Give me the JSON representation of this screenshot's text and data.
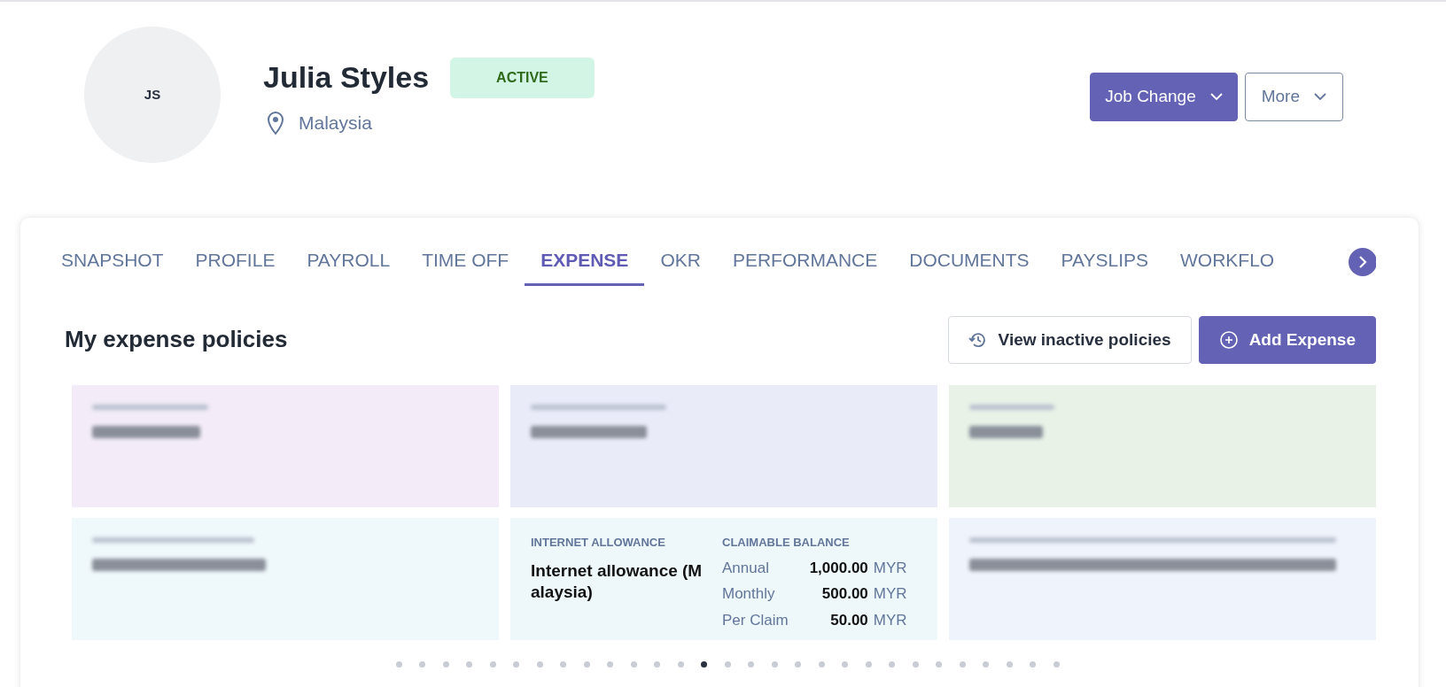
{
  "profile": {
    "initials": "JS",
    "name": "Julia Styles",
    "status": "ACTIVE",
    "location": "Malaysia"
  },
  "actions": [
    {
      "label": "Job Change",
      "kind": "primary"
    },
    {
      "label": "More",
      "kind": "outline"
    }
  ],
  "tabs": [
    {
      "label": "SNAPSHOT",
      "selected": false
    },
    {
      "label": "PROFILE",
      "selected": false
    },
    {
      "label": "PAYROLL",
      "selected": false
    },
    {
      "label": "TIME OFF",
      "selected": false
    },
    {
      "label": "EXPENSE",
      "selected": true
    },
    {
      "label": "OKR",
      "selected": false
    },
    {
      "label": "PERFORMANCE",
      "selected": false
    },
    {
      "label": "DOCUMENTS",
      "selected": false
    },
    {
      "label": "PAYSLIPS",
      "selected": false
    },
    {
      "label": "WORKFLO",
      "selected": false
    }
  ],
  "section": {
    "title": "My expense policies",
    "buttons": [
      {
        "label": "View inactive policies",
        "kind": "outline"
      },
      {
        "label": "Add Expense",
        "kind": "primary"
      }
    ]
  },
  "policies": [
    {
      "color": "#f3ebf8",
      "blurred": true
    },
    {
      "color": "#e9ebf8",
      "blurred": true
    },
    {
      "color": "#e8f2e7",
      "blurred": true
    },
    {
      "color": "#eff8fb",
      "blurred": true
    },
    {
      "category": "INTERNET ALLOWANCE",
      "name": "Internet allowance (M alaysia)",
      "color": "#eef7fa",
      "blurred": false,
      "balance_title": "CLAIMABLE BALANCE",
      "balances": [
        {
          "label": "Annual",
          "amount": "1,000.00",
          "currency": "MYR"
        },
        {
          "label": "Monthly",
          "amount": "500.00",
          "currency": "MYR"
        },
        {
          "label": "Per Claim",
          "amount": "50.00",
          "currency": "MYR"
        }
      ]
    },
    {
      "color": "#eff3fb",
      "blurred": true
    }
  ],
  "pager": [
    {
      "selected": false
    },
    {
      "selected": false
    },
    {
      "selected": false
    },
    {
      "selected": false
    },
    {
      "selected": false
    },
    {
      "selected": false
    },
    {
      "selected": false
    },
    {
      "selected": false
    },
    {
      "selected": false
    },
    {
      "selected": false
    },
    {
      "selected": false
    },
    {
      "selected": false
    },
    {
      "selected": false
    },
    {
      "selected": true
    },
    {
      "selected": false
    },
    {
      "selected": false
    },
    {
      "selected": false
    },
    {
      "selected": false
    },
    {
      "selected": false
    },
    {
      "selected": false
    },
    {
      "selected": false
    },
    {
      "selected": false
    },
    {
      "selected": false
    },
    {
      "selected": false
    },
    {
      "selected": false
    },
    {
      "selected": false
    },
    {
      "selected": false
    },
    {
      "selected": false
    },
    {
      "selected": false
    }
  ]
}
